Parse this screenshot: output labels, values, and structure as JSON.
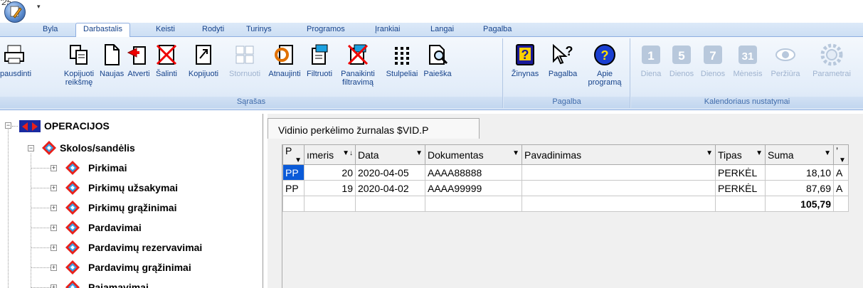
{
  "title_strip": {
    "corner_text": "ʻ25"
  },
  "menu_tabs": [
    "Byla",
    "Darbastalis",
    "Keisti",
    "Rodyti",
    "Turinys",
    "Programos",
    "Įrankiai",
    "Langai",
    "Pagalba"
  ],
  "active_tab": "Darbastalis",
  "ribbon": {
    "groups": [
      {
        "label": "Sąrašas",
        "buttons": [
          {
            "label": "pausdinti",
            "icon": "printer-icon"
          },
          {
            "label": "Kopijuoti reikšmę",
            "icon": "copy-value-icon"
          },
          {
            "label": "Naujas",
            "icon": "new-document-icon"
          },
          {
            "label": "Atverti",
            "icon": "open-folder-icon"
          },
          {
            "label": "Šalinti",
            "icon": "delete-icon"
          },
          {
            "label": "Kopijuoti",
            "icon": "copy-icon"
          },
          {
            "label": "Stornuoti",
            "icon": "storno-icon",
            "disabled": true
          },
          {
            "label": "Atnaujinti",
            "icon": "refresh-icon"
          },
          {
            "label": "Filtruoti",
            "icon": "filter-icon"
          },
          {
            "label": "Panaikinti filtravimą",
            "icon": "remove-filter-icon"
          },
          {
            "label": "Stulpeliai",
            "icon": "columns-icon"
          },
          {
            "label": "Paieška",
            "icon": "search-icon"
          }
        ]
      },
      {
        "label": "Pagalba",
        "buttons": [
          {
            "label": "Žinynas",
            "icon": "help-book-icon"
          },
          {
            "label": "Pagalba",
            "icon": "help-pointer-icon"
          },
          {
            "label": "Apie programą",
            "icon": "about-icon"
          }
        ]
      },
      {
        "label": "Kalendoriaus nustatymai",
        "buttons": [
          {
            "label": "Diena",
            "icon": "calendar-day-icon",
            "disabled": true,
            "badge": "1"
          },
          {
            "label": "Dienos",
            "icon": "calendar-5days-icon",
            "disabled": true,
            "badge": "5"
          },
          {
            "label": "Dienos",
            "icon": "calendar-week-icon",
            "disabled": true,
            "badge": "7"
          },
          {
            "label": "Mėnesis",
            "icon": "calendar-month-icon",
            "disabled": true,
            "badge": "31"
          },
          {
            "label": "Peržiūra",
            "icon": "preview-eye-icon",
            "disabled": true
          },
          {
            "label": "Parametrai",
            "icon": "settings-gear-icon",
            "disabled": true
          }
        ]
      }
    ]
  },
  "tree": {
    "root": "OPERACIJOS",
    "child": "Skolos/sandėlis",
    "items": [
      "Pirkimai",
      "Pirkimų užsakymai",
      "Pirkimų grąžinimai",
      "Pardavimai",
      "Pardavimų rezervavimai",
      "Pardavimų grąžinimai",
      "Pajamavimai"
    ]
  },
  "panel": {
    "tab_title": "Vidinio perkėlimo žurnalas $VID.P",
    "columns": [
      {
        "label": "P",
        "sort": "▼"
      },
      {
        "label": "ımeris",
        "sort": "▼↓"
      },
      {
        "label": "Data",
        "sort": "▼"
      },
      {
        "label": "Dokumentas",
        "sort": "▼"
      },
      {
        "label": "Pavadinimas",
        "sort": "▼"
      },
      {
        "label": "Tipas",
        "sort": "▼"
      },
      {
        "label": "Suma",
        "sort": "▼"
      },
      {
        "label": "’",
        "sort": "▼"
      }
    ],
    "rows": [
      [
        "PP",
        "20",
        "2020-04-05",
        "AAAA88888",
        "",
        "PERKĖL",
        "18,10",
        "A"
      ],
      [
        "PP",
        "19",
        "2020-04-02",
        "AAAA99999",
        "",
        "PERKĖL",
        "87,69",
        "A"
      ]
    ],
    "total": "105,79"
  },
  "colors": {
    "ribbon_text": "#15428b",
    "selection": "#0a5ad8"
  }
}
